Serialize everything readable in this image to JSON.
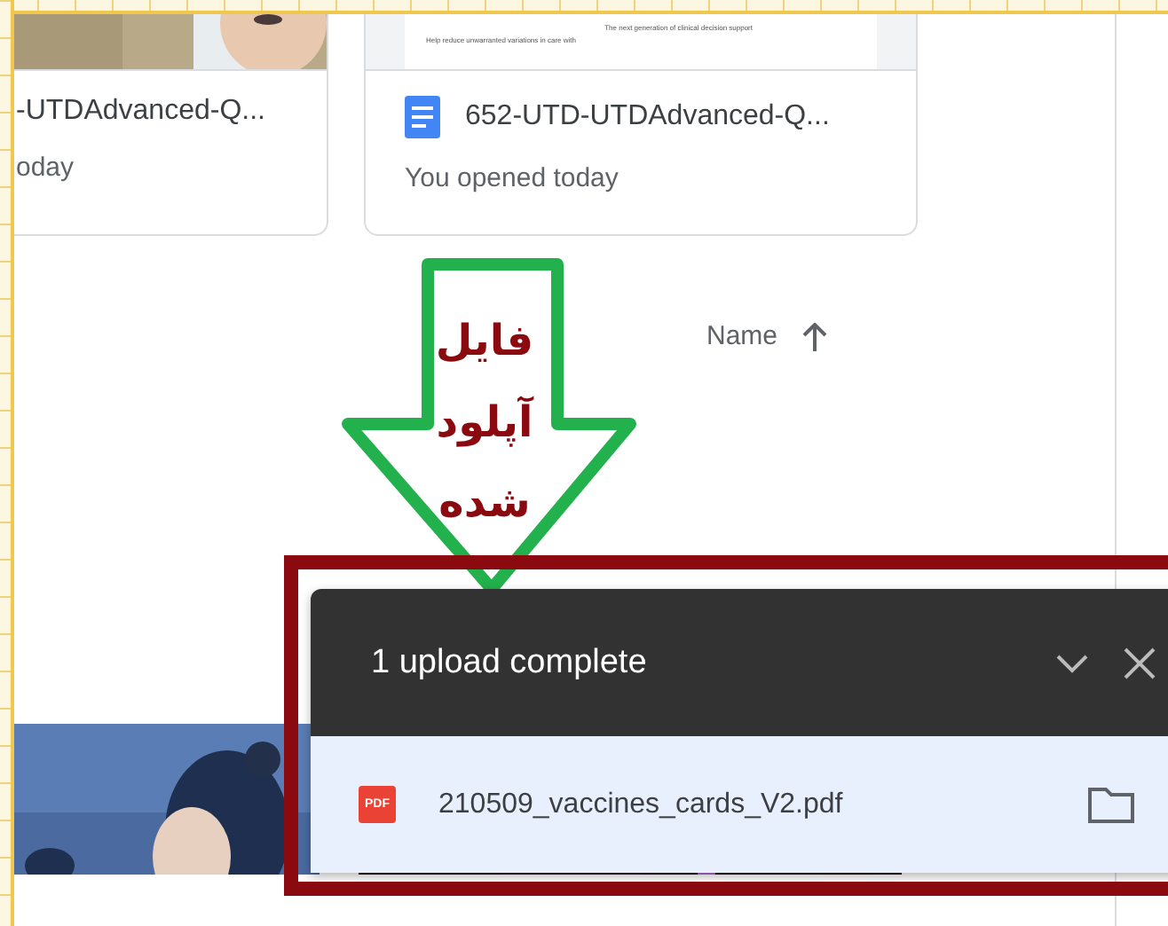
{
  "recent_files": [
    {
      "name": "-UTDAdvanced-Q...",
      "activity": "oday"
    },
    {
      "name": "652-UTD-UTDAdvanced-Q...",
      "activity": "You opened today",
      "thumbnail": {
        "kind": "document",
        "lines": [
          "The next generation of clinical decision support",
          "Help reduce unwarranted variations in care with"
        ]
      }
    }
  ],
  "sort": {
    "label": "Name",
    "ascending": true
  },
  "annotation": {
    "text": "فایل آپلود شده"
  },
  "upload_panel": {
    "title": "1 upload complete",
    "expanded": true,
    "items": [
      {
        "name": "210509_vaccines_cards_V2.pdf",
        "badge": "PDF"
      }
    ]
  }
}
